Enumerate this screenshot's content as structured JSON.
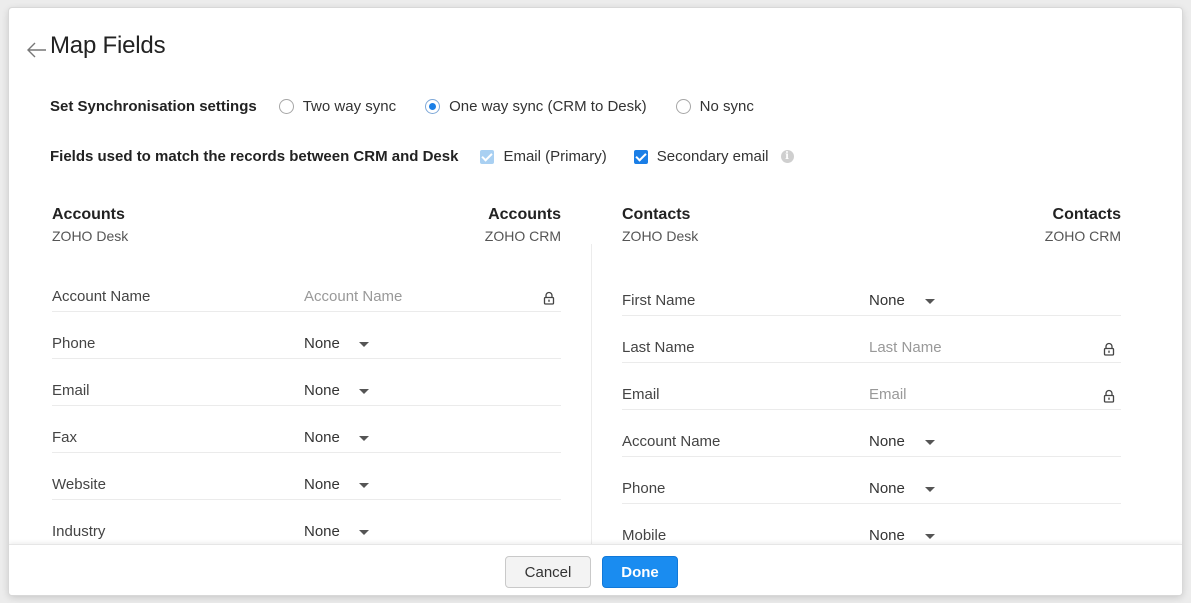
{
  "page": {
    "title": "Map Fields"
  },
  "sync": {
    "label": "Set Synchronisation settings",
    "options": [
      "Two way sync",
      "One way sync (CRM to Desk)",
      "No sync"
    ],
    "selected_index": 1
  },
  "match": {
    "label": "Fields used to match the records between CRM and Desk",
    "options": [
      {
        "label": "Email (Primary)",
        "checked": true,
        "disabled": true
      },
      {
        "label": "Secondary email",
        "checked": true,
        "disabled": false
      }
    ],
    "info_icon": "info-icon"
  },
  "accounts": {
    "desk_title": "Accounts",
    "desk_sub": "ZOHO Desk",
    "crm_title": "Accounts",
    "crm_sub": "ZOHO CRM",
    "rows": [
      {
        "field": "Account Name",
        "value": "Account Name",
        "locked": true
      },
      {
        "field": "Phone",
        "value": "None",
        "locked": false
      },
      {
        "field": "Email",
        "value": "None",
        "locked": false
      },
      {
        "field": "Fax",
        "value": "None",
        "locked": false
      },
      {
        "field": "Website",
        "value": "None",
        "locked": false
      },
      {
        "field": "Industry",
        "value": "None",
        "locked": false
      }
    ]
  },
  "contacts": {
    "desk_title": "Contacts",
    "desk_sub": "ZOHO Desk",
    "crm_title": "Contacts",
    "crm_sub": "ZOHO CRM",
    "rows": [
      {
        "field": "First Name",
        "value": "None",
        "locked": false
      },
      {
        "field": "Last Name",
        "value": "Last Name",
        "locked": true
      },
      {
        "field": "Email",
        "value": "Email",
        "locked": true
      },
      {
        "field": "Account Name",
        "value": "None",
        "locked": false
      },
      {
        "field": "Phone",
        "value": "None",
        "locked": false
      },
      {
        "field": "Mobile",
        "value": "None",
        "locked": false
      }
    ]
  },
  "footer": {
    "cancel_label": "Cancel",
    "done_label": "Done"
  },
  "colors": {
    "accent": "#1a8cf0",
    "check": "#1a7ee6"
  }
}
